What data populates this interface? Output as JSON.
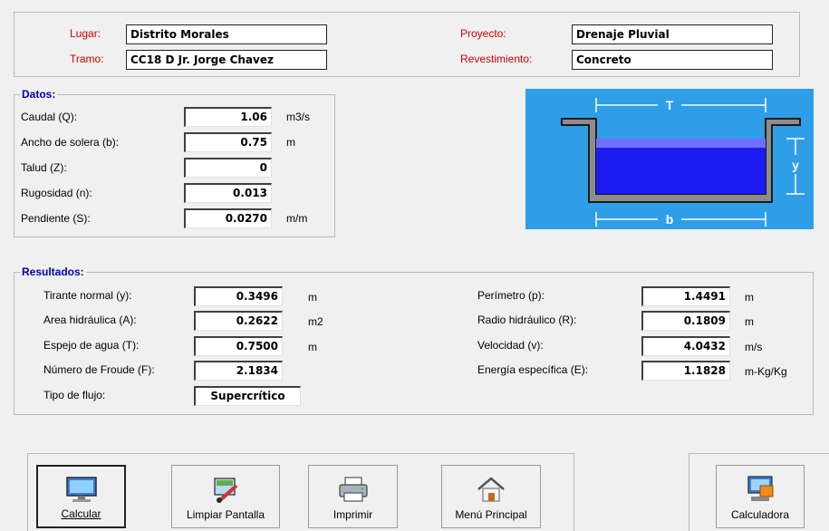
{
  "header": {
    "lugar_label": "Lugar:",
    "lugar_value": "Distrito Morales",
    "tramo_label": "Tramo:",
    "tramo_value": "CC18 D Jr. Jorge Chavez",
    "proyecto_label": "Proyecto:",
    "proyecto_value": "Drenaje Pluvial",
    "revestimiento_label": "Revestimiento:",
    "revestimiento_value": "Concreto"
  },
  "datos": {
    "title": "Datos:",
    "rows": [
      {
        "label": "Caudal (Q):",
        "value": "1.06",
        "unit": "m3/s"
      },
      {
        "label": "Ancho de solera (b):",
        "value": "0.75",
        "unit": "m"
      },
      {
        "label": "Talud (Z):",
        "value": "0",
        "unit": ""
      },
      {
        "label": "Rugosidad (n):",
        "value": "0.013",
        "unit": ""
      },
      {
        "label": "Pendiente (S):",
        "value": "0.0270",
        "unit": "m/m"
      }
    ]
  },
  "diagram": {
    "T": "T",
    "y": "y",
    "b": "b"
  },
  "resultados": {
    "title": "Resultados:",
    "left": [
      {
        "label": "Tirante normal (y):",
        "value": "0.3496",
        "unit": "m"
      },
      {
        "label": "Area hidráulica (A):",
        "value": "0.2622",
        "unit": "m2"
      },
      {
        "label": "Espejo de agua (T):",
        "value": "0.7500",
        "unit": "m"
      },
      {
        "label": "Número de Froude (F):",
        "value": "2.1834",
        "unit": ""
      }
    ],
    "flujo_label": "Tipo de flujo:",
    "flujo_value": "Supercrítico",
    "right": [
      {
        "label": "Perímetro (p):",
        "value": "1.4491",
        "unit": "m"
      },
      {
        "label": "Radio hidráulico (R):",
        "value": "0.1809",
        "unit": "m"
      },
      {
        "label": "Velocidad (v):",
        "value": "4.0432",
        "unit": "m/s"
      },
      {
        "label": "Energía específica (E):",
        "value": "1.1828",
        "unit": "m-Kg/Kg"
      }
    ]
  },
  "buttons": {
    "calcular": "Calcular",
    "limpiar": "Limpiar Pantalla",
    "imprimir": "Imprimir",
    "menu": "Menú Principal",
    "calculadora": "Calculadora"
  },
  "icons": {
    "calcular": "monitor-icon",
    "limpiar": "paint-brush-icon",
    "imprimir": "printer-icon",
    "menu": "house-icon",
    "calculadora": "calculator-icon"
  },
  "colors": {
    "label_red": "#d00000",
    "group_title_blue": "#0000b0",
    "diagram_sky": "#2f9ee8",
    "water": "#2020e8"
  }
}
